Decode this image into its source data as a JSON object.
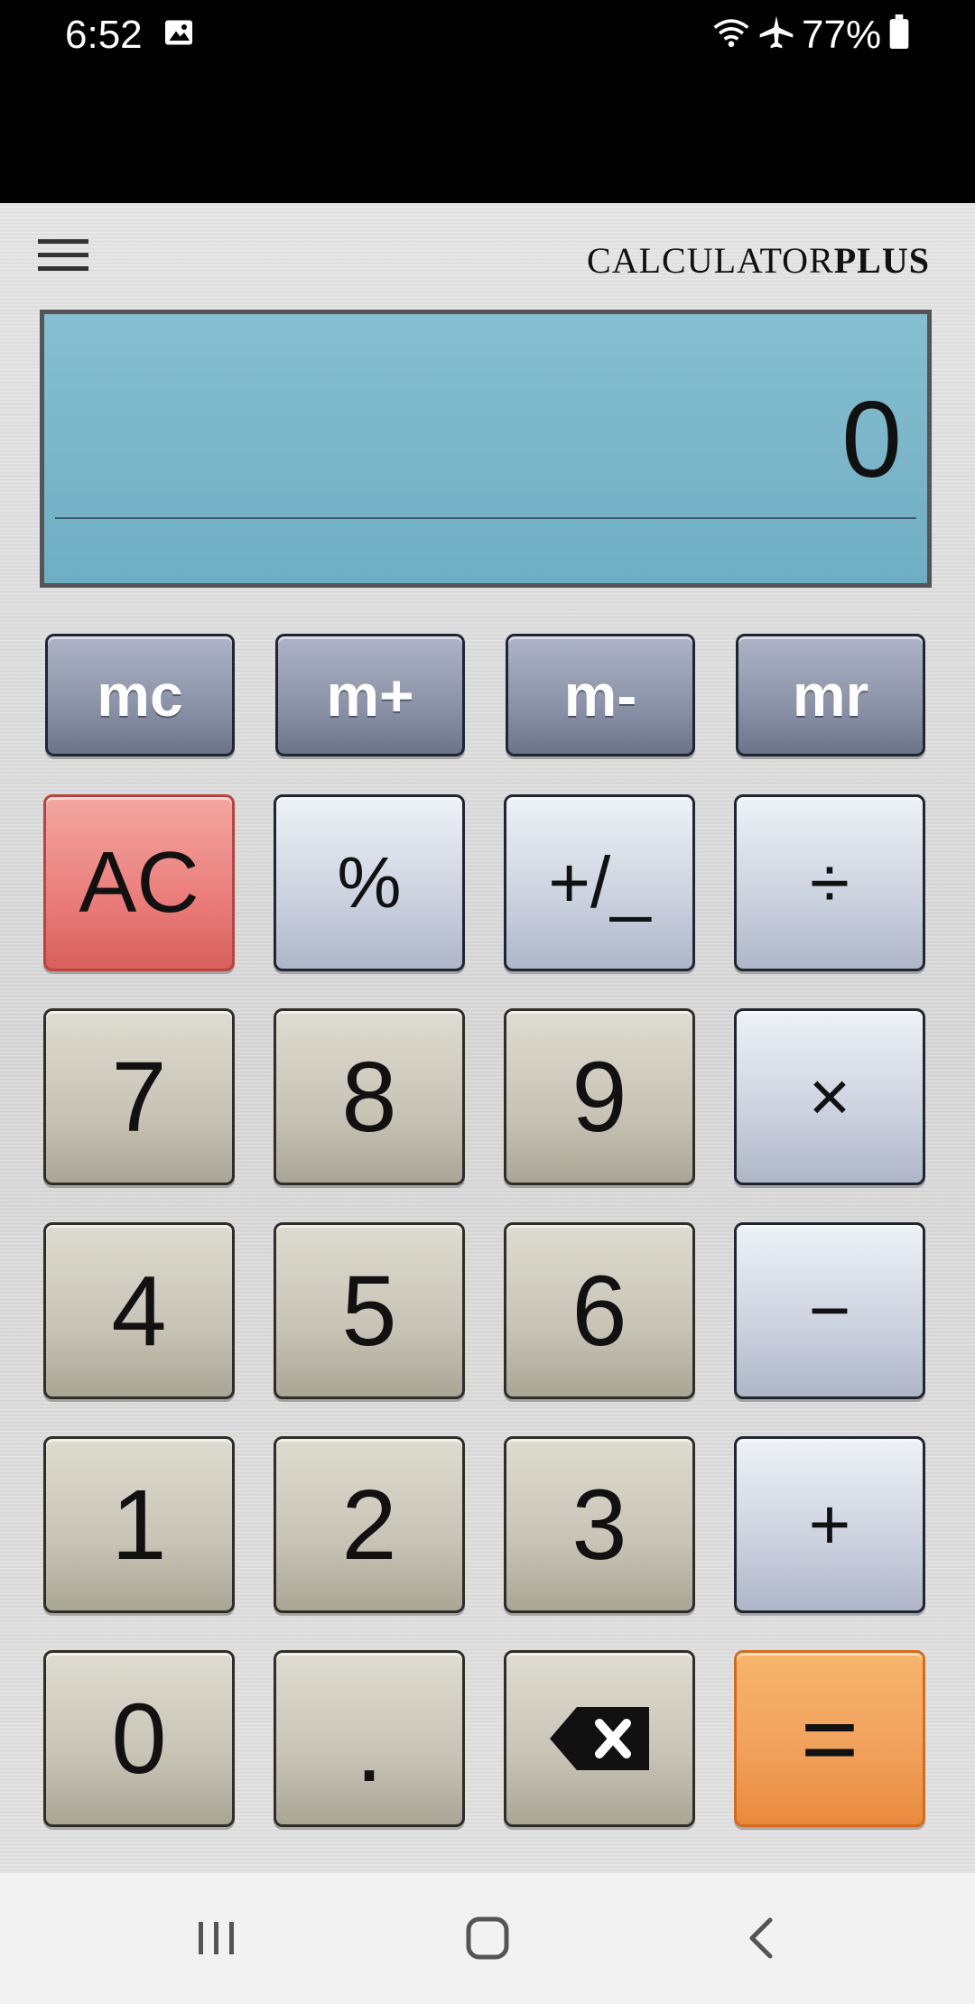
{
  "status_bar": {
    "time": "6:52",
    "battery": "77%",
    "icons": [
      "gallery-icon",
      "wifi-icon",
      "airplane-icon",
      "battery-icon"
    ]
  },
  "app": {
    "brand_regular": "CALCULATOR",
    "brand_bold": "PLUS",
    "display_value": "0"
  },
  "memory_keys": {
    "mc": "mc",
    "mplus": "m+",
    "mminus": "m-",
    "mr": "mr"
  },
  "keys": {
    "ac": "AC",
    "percent": "%",
    "plusminus": "+/_",
    "divide": "÷",
    "seven": "7",
    "eight": "8",
    "nine": "9",
    "multiply": "×",
    "four": "4",
    "five": "5",
    "six": "6",
    "minus": "−",
    "one": "1",
    "two": "2",
    "three": "3",
    "plus": "+",
    "zero": "0",
    "dot": ".",
    "equals": "="
  },
  "colors": {
    "display": "#7ab6ca",
    "memory_key": "#8a92a8",
    "ac_key": "#ea7d7a",
    "equals_key": "#f0a05a"
  }
}
